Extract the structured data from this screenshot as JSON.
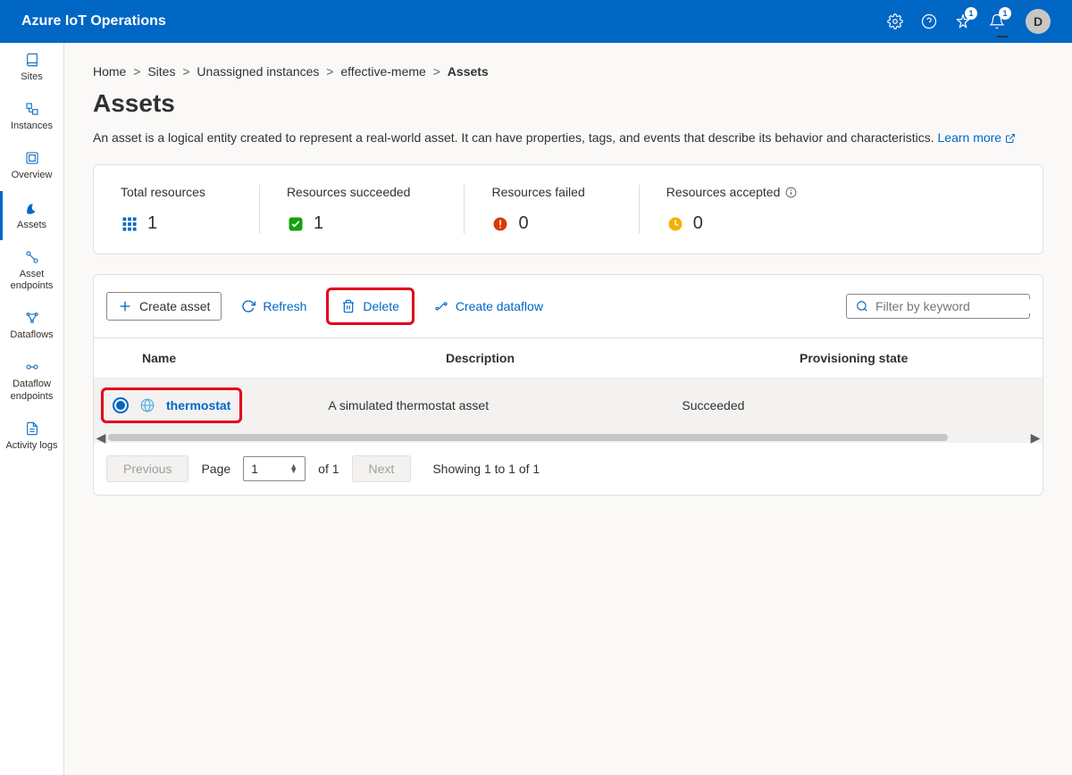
{
  "header": {
    "title": "Azure IoT Operations",
    "badge1": "1",
    "badge2": "1",
    "avatar": "D"
  },
  "sidebar": {
    "items": [
      {
        "label": "Sites"
      },
      {
        "label": "Instances"
      },
      {
        "label": "Overview"
      },
      {
        "label": "Assets"
      },
      {
        "label": "Asset endpoints"
      },
      {
        "label": "Dataflows"
      },
      {
        "label": "Dataflow endpoints"
      },
      {
        "label": "Activity logs"
      }
    ]
  },
  "breadcrumb": {
    "items": [
      "Home",
      "Sites",
      "Unassigned instances",
      "effective-meme"
    ],
    "current": "Assets"
  },
  "page": {
    "title": "Assets",
    "description": "An asset is a logical entity created to represent a real-world asset. It can have properties, tags, and events that describe its behavior and characteristics. ",
    "learn_more": "Learn more"
  },
  "stats": {
    "total": {
      "label": "Total resources",
      "value": "1"
    },
    "succeeded": {
      "label": "Resources succeeded",
      "value": "1"
    },
    "failed": {
      "label": "Resources failed",
      "value": "0"
    },
    "accepted": {
      "label": "Resources accepted",
      "value": "0"
    }
  },
  "toolbar": {
    "create": "Create asset",
    "refresh": "Refresh",
    "delete": "Delete",
    "dataflow": "Create dataflow",
    "filter_placeholder": "Filter by keyword"
  },
  "table": {
    "headers": {
      "name": "Name",
      "description": "Description",
      "provisioning": "Provisioning state"
    },
    "rows": [
      {
        "name": "thermostat",
        "description": "A simulated thermostat asset",
        "provisioning": "Succeeded"
      }
    ]
  },
  "pagination": {
    "previous": "Previous",
    "page_label": "Page",
    "page_value": "1",
    "of_label": "of 1",
    "next": "Next",
    "showing": "Showing 1 to 1 of 1"
  }
}
